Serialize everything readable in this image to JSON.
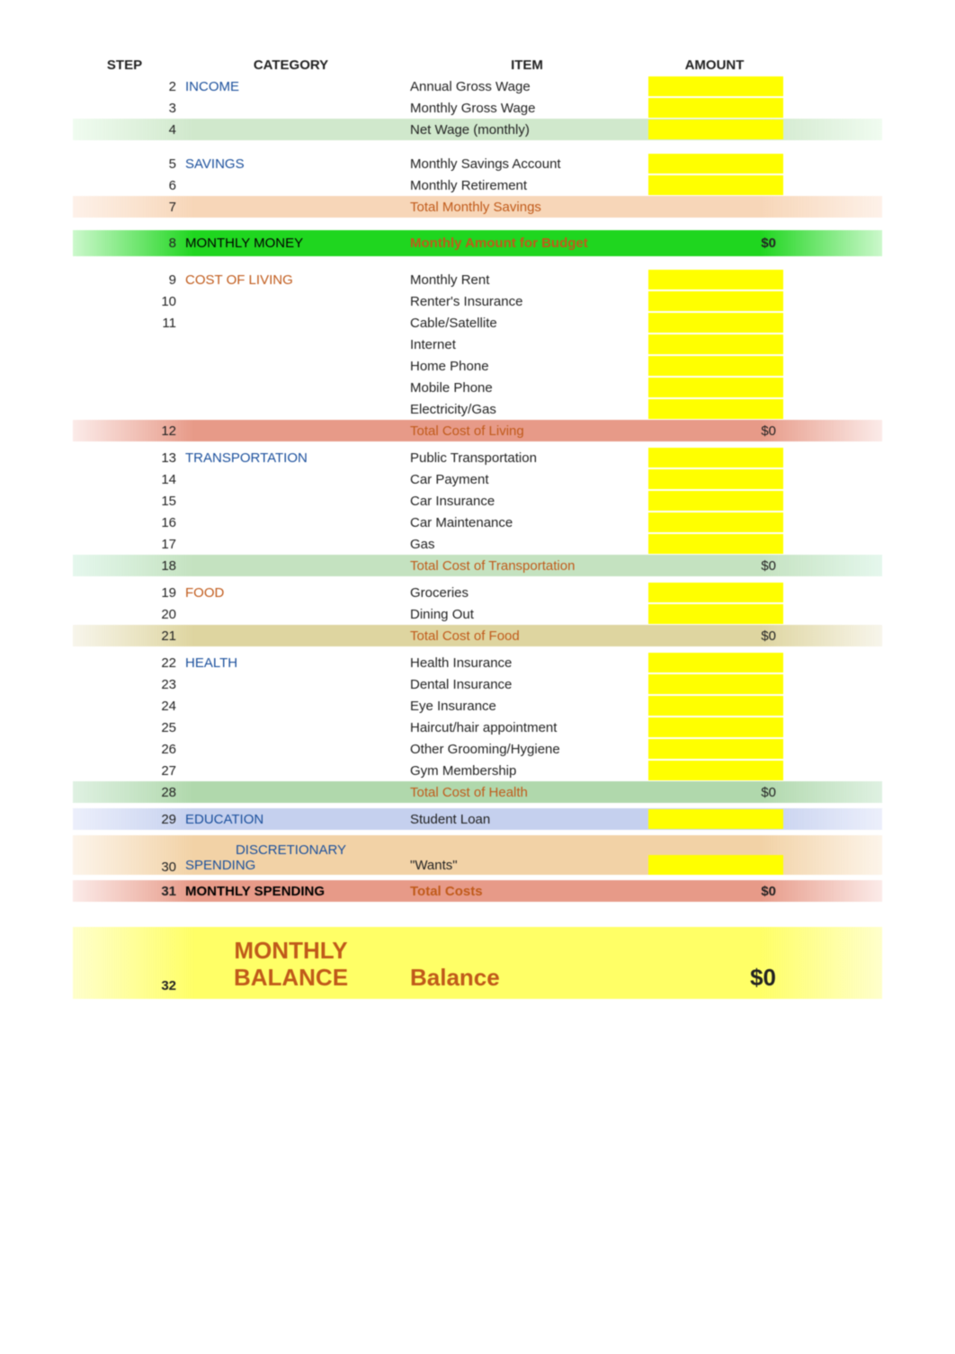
{
  "headers": {
    "step": "STEP",
    "category": "CATEGORY",
    "item": "ITEM",
    "amount": "AMOUNT"
  },
  "rows": {
    "r2": {
      "step": "2",
      "category": "INCOME",
      "item": "Annual Gross Wage"
    },
    "r3": {
      "step": "3",
      "category": "",
      "item": "Monthly Gross Wage"
    },
    "r4": {
      "step": "4",
      "category": "",
      "item": "Net Wage (monthly)"
    },
    "r5": {
      "step": "5",
      "category": "SAVINGS",
      "item": "Monthly Savings Account"
    },
    "r6": {
      "step": "6",
      "category": "",
      "item": "Monthly Retirement"
    },
    "r7": {
      "step": "7",
      "category": "",
      "item": "Total Monthly Savings"
    },
    "r8": {
      "step": "8",
      "category": "MONTHLY MONEY",
      "item": "Monthly Amount for Budget",
      "amount": "$0"
    },
    "r9": {
      "step": "9",
      "category": "COST OF LIVING",
      "item": "Monthly Rent"
    },
    "r10": {
      "step": "10",
      "category": "",
      "item": "Renter's Insurance"
    },
    "r11": {
      "step": "11",
      "category": "",
      "item": "Cable/Satellite"
    },
    "r11b": {
      "item": "Internet"
    },
    "r11c": {
      "item": "Home Phone"
    },
    "r11d": {
      "item": "Mobile Phone"
    },
    "r11e": {
      "item": "Electricity/Gas"
    },
    "r12": {
      "step": "12",
      "category": "",
      "item": "Total Cost of Living",
      "amount": "$0"
    },
    "r13": {
      "step": "13",
      "category": "TRANSPORTATION",
      "item": "Public Transportation"
    },
    "r14": {
      "step": "14",
      "category": "",
      "item": "Car Payment"
    },
    "r15": {
      "step": "15",
      "category": "",
      "item": "Car Insurance"
    },
    "r16": {
      "step": "16",
      "category": "",
      "item": "Car Maintenance"
    },
    "r17": {
      "step": "17",
      "category": "",
      "item": "Gas"
    },
    "r18": {
      "step": "18",
      "category": "",
      "item": "Total Cost of Transportation",
      "amount": "$0"
    },
    "r19": {
      "step": "19",
      "category": "FOOD",
      "item": "Groceries"
    },
    "r20": {
      "step": "20",
      "category": "",
      "item": "Dining Out"
    },
    "r21": {
      "step": "21",
      "category": "",
      "item": "Total Cost of Food",
      "amount": "$0"
    },
    "r22": {
      "step": "22",
      "category": "HEALTH",
      "item": "Health Insurance"
    },
    "r23": {
      "step": "23",
      "category": "",
      "item": "Dental Insurance"
    },
    "r24": {
      "step": "24",
      "category": "",
      "item": "Eye Insurance"
    },
    "r25": {
      "step": "25",
      "category": "",
      "item": "Haircut/hair appointment"
    },
    "r26": {
      "step": "26",
      "category": "",
      "item": "Other Grooming/Hygiene"
    },
    "r27": {
      "step": "27",
      "category": "",
      "item": "Gym Membership"
    },
    "r28": {
      "step": "28",
      "category": "",
      "item": "Total Cost of Health",
      "amount": "$0"
    },
    "r29": {
      "step": "29",
      "category": "EDUCATION",
      "item": "Student Loan"
    },
    "r30": {
      "step": "30",
      "category_l1": "DISCRETIONARY",
      "category_l2": "SPENDING",
      "item": "\"Wants\""
    },
    "r31": {
      "step": "31",
      "category": "MONTHLY SPENDING",
      "item": "Total Costs",
      "amount": "$0"
    },
    "r32": {
      "step": "32",
      "category_l1": "MONTHLY",
      "category_l2": "BALANCE",
      "item": "Balance",
      "amount": "$0"
    }
  }
}
